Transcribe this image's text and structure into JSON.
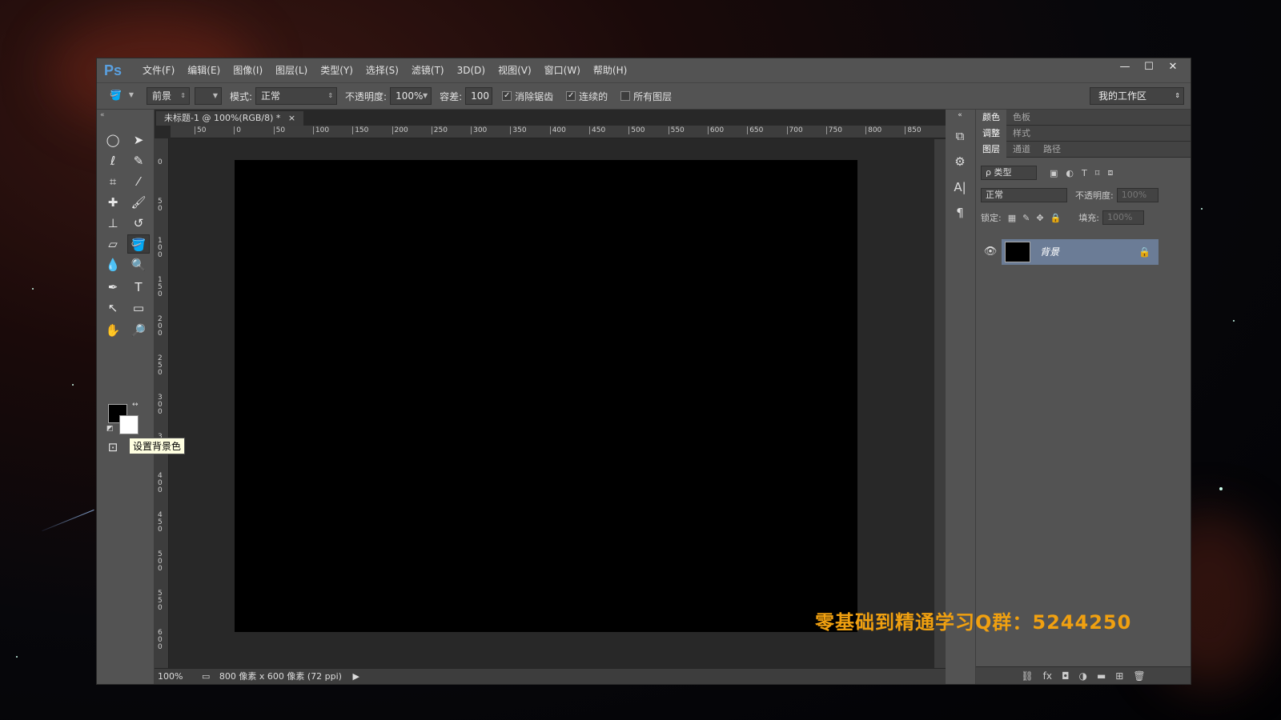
{
  "app": {
    "logo": "Ps",
    "menu": [
      "文件(F)",
      "编辑(E)",
      "图像(I)",
      "图层(L)",
      "类型(Y)",
      "选择(S)",
      "滤镜(T)",
      "3D(D)",
      "视图(V)",
      "窗口(W)",
      "帮助(H)"
    ],
    "window_controls": [
      "—",
      "☐",
      "✕"
    ]
  },
  "options": {
    "fill_source": "前景",
    "mode_label": "模式:",
    "mode_value": "正常",
    "opacity_label": "不透明度:",
    "opacity_value": "100%",
    "tolerance_label": "容差:",
    "tolerance_value": "100",
    "antialias_label": "消除锯齿",
    "contiguous_label": "连续的",
    "all_layers_label": "所有图层",
    "antialias_checked": true,
    "contiguous_checked": true,
    "all_layers_checked": false,
    "workspace": "我的工作区"
  },
  "document": {
    "tab_title": "未标题-1 @ 100%(RGB/8) *",
    "tab_close": "×",
    "ruler_top_labels": [
      "50",
      "0",
      "50",
      "100",
      "150",
      "200",
      "250",
      "300",
      "350",
      "400",
      "450",
      "500",
      "550",
      "600",
      "650",
      "700",
      "750",
      "800",
      "850"
    ],
    "ruler_left_labels": [
      "0",
      "50",
      "100",
      "150",
      "200",
      "250",
      "300",
      "350",
      "400",
      "450",
      "500",
      "550",
      "600"
    ]
  },
  "status": {
    "zoom": "100%",
    "doc_info": "800 像素 x 600 像素 (72 ppi)"
  },
  "tooltip": "设置背景色",
  "panels": {
    "group1_tabs": [
      "颜色",
      "色板"
    ],
    "group2_tabs": [
      "调整",
      "样式"
    ],
    "group3_tabs": [
      "图层",
      "通道",
      "路径"
    ],
    "filter_kind": "ρ 类型",
    "blend_mode": "正常",
    "opacity_label": "不透明度:",
    "opacity_value": "100%",
    "lock_label": "锁定:",
    "fill_label": "填充:",
    "fill_value": "100%",
    "layer_name": "背景"
  },
  "watermark": "零基础到精通学习Q群：5244250"
}
